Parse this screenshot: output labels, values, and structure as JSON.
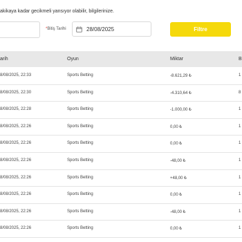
{
  "notice": "akikaya kadar gecikmeli yansıyor olabilir, bilgilerinize.",
  "filters": {
    "end_date_label": "Bitiş Tarihi",
    "end_date_value": "28/08/2025",
    "filter_button": "Filtre"
  },
  "table": {
    "headers": {
      "date": "arih",
      "game": "Oyun",
      "amount": "Miktar",
      "balance": "B"
    },
    "rows": [
      {
        "date": "8/08/2025, 22:33",
        "game": "Sports Betting",
        "amount": "-8.621,29 ₺",
        "balance": "1"
      },
      {
        "date": "8/08/2025, 22:30",
        "game": "Sports Betting",
        "amount": "-4.310,64 ₺",
        "balance": "8"
      },
      {
        "date": "8/08/2025, 22:28",
        "game": "Sports Betting",
        "amount": "-1.000,00 ₺",
        "balance": "1"
      },
      {
        "date": "8/08/2025, 22:26",
        "game": "Sports Betting",
        "amount": "0,00 ₺",
        "balance": "1"
      },
      {
        "date": "8/08/2025, 22:26",
        "game": "Sports Betting",
        "amount": "0,00 ₺",
        "balance": "1"
      },
      {
        "date": "8/08/2025, 22:26",
        "game": "Sports Betting",
        "amount": "-48,00 ₺",
        "balance": "1"
      },
      {
        "date": "8/08/2025, 22:26",
        "game": "Sports Betting",
        "amount": "+48,00 ₺",
        "balance": "1"
      },
      {
        "date": "8/08/2025, 22:26",
        "game": "Sports Betting",
        "amount": "0,00 ₺",
        "balance": "1"
      },
      {
        "date": "8/08/2025, 22:26",
        "game": "Sports Betting",
        "amount": "-48,00 ₺",
        "balance": "1"
      },
      {
        "date": "8/08/2025, 22:26",
        "game": "Sports Betting",
        "amount": "0,00 ₺",
        "balance": "1"
      }
    ]
  },
  "colors": {
    "accent": "#f5d90b",
    "header_bg": "#e8e8e8",
    "required": "#e4352c"
  },
  "icons": {
    "date_picker": "calendar-icon"
  }
}
